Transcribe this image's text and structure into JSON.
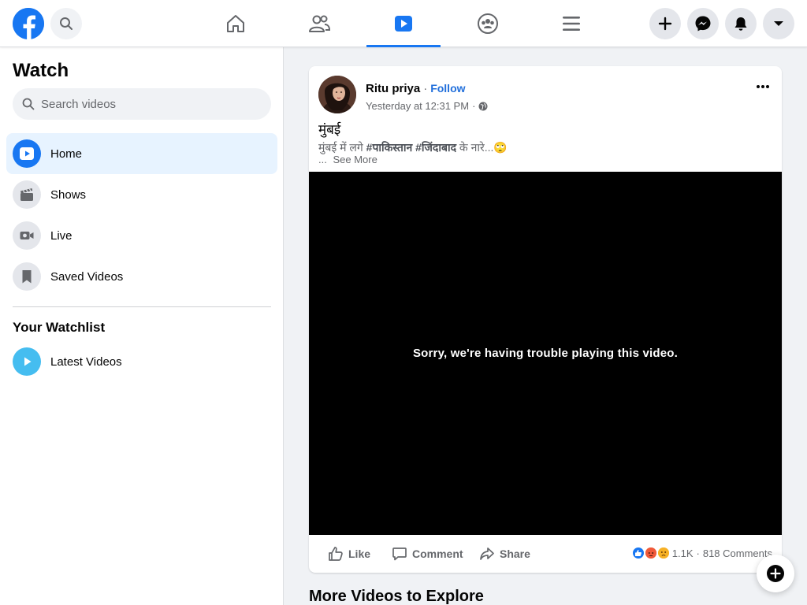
{
  "topbar": {
    "nav": [
      "home",
      "friends",
      "watch",
      "groups",
      "menu"
    ],
    "active_tab": "watch",
    "brand_color": "#1877f2"
  },
  "sidebar": {
    "title": "Watch",
    "search_placeholder": "Search videos",
    "items": [
      {
        "label": "Home",
        "icon": "play-video-icon",
        "active": true
      },
      {
        "label": "Shows",
        "icon": "clapperboard-icon"
      },
      {
        "label": "Live",
        "icon": "live-camera-icon"
      },
      {
        "label": "Saved Videos",
        "icon": "bookmark-icon"
      }
    ],
    "watchlist_title": "Your Watchlist",
    "watchlist": [
      {
        "label": "Latest Videos",
        "icon": "play-circle-icon"
      }
    ]
  },
  "post": {
    "author": "Ritu priya",
    "separator": "·",
    "follow_label": "Follow",
    "timestamp": "Yesterday at 12:31 PM",
    "meta_sep": "·",
    "privacy_icon": "globe-icon",
    "title": "मुंबई",
    "text_start": "मुंबई में लगे ",
    "hashtag1": "#पाकिस्तान",
    "hashtag2": "#जिंदाबाद",
    "text_end": " के नारे...",
    "emoji": "🙄",
    "see_more_prefix": "...",
    "see_more": "See More",
    "video_message": "Sorry, we're having trouble playing this video.",
    "actions": {
      "like": "Like",
      "comment": "Comment",
      "share": "Share"
    },
    "reactions_count": "1.1K",
    "reactions_sep": "·",
    "comments_count": "818 Comments"
  },
  "more_videos_title": "More Videos to Explore"
}
